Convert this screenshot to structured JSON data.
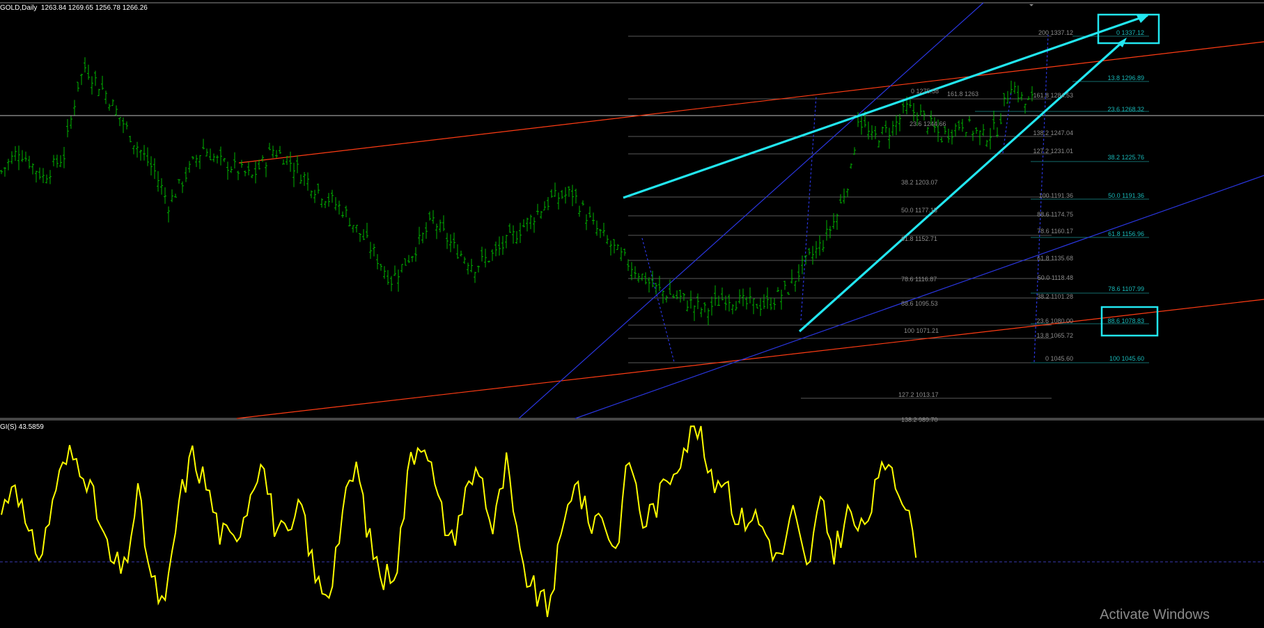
{
  "header": {
    "symbol": "GOLD,Daily",
    "ohlc": "1263.84 1269.65 1256.78 1266.26",
    "indicator": "GI(S) 43.5859"
  },
  "watermark": "Activate Windows",
  "colors": {
    "background": "#000000",
    "candles": "#00b400",
    "trend_arrows": "#22e6f0",
    "channel_lines": "#ff3c14",
    "blue_lines": "#2a36e0",
    "fib_text_left": "#8c8c8c",
    "fib_text_right": "#18b8b8",
    "indicator_line": "#ffff00"
  },
  "chart_data": [
    {
      "type": "line",
      "name": "price",
      "x_label": "",
      "y_label": "",
      "ylim": [
        980,
        1345
      ],
      "n_bars": 300,
      "series": [
        {
          "name": "GOLD",
          "anchors": [
            [
              0,
              1200
            ],
            [
              5,
              1220
            ],
            [
              12,
              1195
            ],
            [
              18,
              1215
            ],
            [
              22,
              1280
            ],
            [
              24,
              1296
            ],
            [
              30,
              1272
            ],
            [
              38,
              1228
            ],
            [
              44,
              1200
            ],
            [
              48,
              1170
            ],
            [
              54,
              1202
            ],
            [
              58,
              1222
            ],
            [
              62,
              1210
            ],
            [
              66,
              1205
            ],
            [
              72,
              1195
            ],
            [
              78,
              1220
            ],
            [
              82,
              1212
            ],
            [
              90,
              1185
            ],
            [
              98,
              1165
            ],
            [
              106,
              1130
            ],
            [
              112,
              1100
            ],
            [
              118,
              1125
            ],
            [
              124,
              1155
            ],
            [
              130,
              1130
            ],
            [
              136,
              1113
            ],
            [
              142,
              1125
            ],
            [
              150,
              1150
            ],
            [
              158,
              1175
            ],
            [
              164,
              1180
            ],
            [
              170,
              1150
            ],
            [
              178,
              1122
            ],
            [
              188,
              1092
            ],
            [
              196,
              1082
            ],
            [
              202,
              1072
            ],
            [
              208,
              1085
            ],
            [
              214,
              1078
            ],
            [
              220,
              1078
            ],
            [
              226,
              1092
            ],
            [
              230,
              1112
            ],
            [
              236,
              1135
            ],
            [
              240,
              1160
            ],
            [
              244,
              1200
            ],
            [
              246,
              1250
            ],
            [
              250,
              1230
            ],
            [
              256,
              1240
            ],
            [
              260,
              1258
            ],
            [
              264,
              1252
            ],
            [
              270,
              1232
            ],
            [
              276,
              1245
            ],
            [
              282,
              1232
            ],
            [
              286,
              1240
            ],
            [
              290,
              1282
            ],
            [
              294,
              1262
            ],
            [
              296,
              1266
            ]
          ]
        }
      ],
      "fibonacci_left": [
        "0 1275.58",
        "161.8 1263",
        "23.6 1244.66",
        "38.2 1203.07",
        "50.0 1177.15",
        "61.8 1152.71",
        "78.6 1116.87",
        "88.6 1095.53",
        "100 1071.21",
        "127.2 1013.17",
        "138.2 989.70"
      ],
      "fibonacci_middle": [
        "200 1337.12",
        "161.8 1284.53",
        "138.2 1247.04",
        "127.2 1231.01",
        "100 1191.36",
        "88.6 1174.75",
        "78.6 1160.17",
        "61.8 1135.68",
        "50.0 1118.48",
        "38.2 1101.28",
        "23.6 1080.00",
        "13.8 1065.72",
        "0 1045.60"
      ],
      "fibonacci_right": [
        "0 1337.12",
        "13.8 1296.89",
        "23.6 1268.32",
        "38.2 1225.76",
        "50.0 1191.36",
        "61.8 1156.96",
        "78.6 1107.99",
        "88.6 1078.83",
        "100 1045.60"
      ]
    },
    {
      "type": "line",
      "name": "indicator",
      "ylim": [
        0,
        100
      ],
      "n_bars": 300,
      "series": [
        {
          "name": "GI(S)",
          "anchors": [
            [
              0,
              55
            ],
            [
              4,
              75
            ],
            [
              8,
              40
            ],
            [
              12,
              35
            ],
            [
              16,
              70
            ],
            [
              20,
              85
            ],
            [
              24,
              80
            ],
            [
              28,
              55
            ],
            [
              32,
              30
            ],
            [
              36,
              25
            ],
            [
              40,
              65
            ],
            [
              44,
              20
            ],
            [
              48,
              5
            ],
            [
              52,
              60
            ],
            [
              56,
              85
            ],
            [
              60,
              70
            ],
            [
              64,
              45
            ],
            [
              68,
              40
            ],
            [
              72,
              60
            ],
            [
              76,
              85
            ],
            [
              80,
              50
            ],
            [
              84,
              40
            ],
            [
              88,
              60
            ],
            [
              92,
              20
            ],
            [
              96,
              15
            ],
            [
              100,
              55
            ],
            [
              104,
              80
            ],
            [
              108,
              40
            ],
            [
              112,
              20
            ],
            [
              116,
              30
            ],
            [
              120,
              85
            ],
            [
              124,
              95
            ],
            [
              128,
              60
            ],
            [
              132,
              40
            ],
            [
              136,
              65
            ],
            [
              140,
              80
            ],
            [
              144,
              45
            ],
            [
              148,
              80
            ],
            [
              152,
              30
            ],
            [
              156,
              15
            ],
            [
              160,
              5
            ],
            [
              164,
              40
            ],
            [
              168,
              75
            ],
            [
              172,
              50
            ],
            [
              176,
              55
            ],
            [
              180,
              35
            ],
            [
              184,
              85
            ],
            [
              188,
              50
            ],
            [
              192,
              60
            ],
            [
              196,
              75
            ],
            [
              200,
              90
            ],
            [
              204,
              100
            ],
            [
              208,
              70
            ],
            [
              212,
              75
            ],
            [
              216,
              50
            ],
            [
              220,
              55
            ],
            [
              224,
              45
            ],
            [
              228,
              30
            ],
            [
              232,
              55
            ],
            [
              236,
              25
            ],
            [
              240,
              60
            ],
            [
              244,
              35
            ],
            [
              248,
              55
            ],
            [
              252,
              45
            ],
            [
              256,
              65
            ],
            [
              260,
              85
            ],
            [
              264,
              65
            ],
            [
              266,
              50
            ],
            [
              268,
              40
            ]
          ]
        }
      ]
    }
  ]
}
